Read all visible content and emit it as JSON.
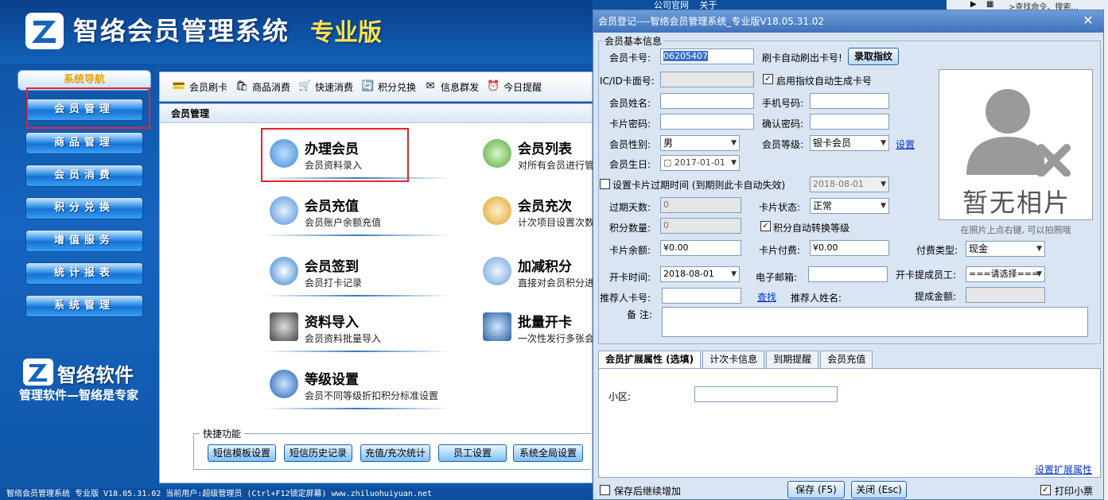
{
  "main": {
    "app_title": "智络会员管理系统",
    "app_edition": "专业版",
    "nav_title": "系统导航",
    "nav_items": [
      "会员管理",
      "商品管理",
      "会员消费",
      "积分兑换",
      "增值服务",
      "统计报表",
      "系统管理"
    ],
    "brand_name": "智络软件",
    "brand_slogan": "管理软件—智络是专家",
    "toolbar": [
      "会员刷卡",
      "商品消费",
      "快速消费",
      "积分兑换",
      "信息群发",
      "今日提醒"
    ],
    "content_title": "会员管理",
    "features": [
      {
        "title": "办理会员",
        "desc": "会员资料录入"
      },
      {
        "title": "会员列表",
        "desc": "对所有会员进行管"
      },
      {
        "title": "会员充值",
        "desc": "会员账户余额充值"
      },
      {
        "title": "会员充次",
        "desc": "计次项目设置次数"
      },
      {
        "title": "会员签到",
        "desc": "会员打卡记录"
      },
      {
        "title": "加减积分",
        "desc": "直接对会员积分进"
      },
      {
        "title": "资料导入",
        "desc": "会员资料批量导入"
      },
      {
        "title": "批量开卡",
        "desc": "一次性发行多张会"
      },
      {
        "title": "等级设置",
        "desc": "会员不同等级折扣积分标准设置"
      }
    ],
    "quick_title": "快捷功能",
    "quick_buttons": [
      "短信模板设置",
      "短信历史记录",
      "充值/充次统计",
      "员工设置",
      "系统全局设置"
    ],
    "statusbar": "智络会员管理系统 专业版 V18.05.31.02 当前用户:超级管理员 (Ctrl+F12锁定屏幕)      www.zhiluohuiyuan.net",
    "top_links": [
      "公司官网",
      "关于"
    ],
    "top_search": ">查找命令、搜索..."
  },
  "dialog": {
    "title": "会员登记----智络会员管理系统_专业版V18.05.31.02",
    "close": "✕",
    "basic_legend": "会员基本信息",
    "card_no_label": "会员卡号:",
    "card_no_value": "06205407",
    "swipe_hint": "刷卡自动刷出卡号!",
    "fingerprint_button": "录取指纹",
    "icid_label": "IC/ID卡面号:",
    "auto_fp_label": "启用指纹自动生成卡号",
    "name_label": "会员姓名:",
    "phone_label": "手机号码:",
    "pwd_label": "卡片密码:",
    "confirm_pwd_label": "确认密码:",
    "gender_label": "会员性别:",
    "gender_value": "男",
    "level_label": "会员等级:",
    "level_value": "银卡会员",
    "level_link": "设置",
    "birthday_label": "会员生日:",
    "birthday_value": "2017-01-01",
    "expire_chk_label": "设置卡片过期时间 (到期则此卡自动失效)",
    "expire_value": "2018-08-01",
    "expire_days_label": "过期天数:",
    "expire_days_value": "0",
    "card_status_label": "卡片状态:",
    "card_status_value": "正常",
    "points_label": "积分数量:",
    "points_value": "0",
    "auto_level_label": "积分自动转换等级",
    "balance_label": "卡片余额:",
    "balance_value": "¥0.00",
    "card_fee_label": "卡片付费:",
    "card_fee_value": "¥0.00",
    "pay_type_label": "付费类型:",
    "pay_type_value": "现金",
    "open_time_label": "开卡时间:",
    "open_time_value": "2018-08-01",
    "email_label": "电子邮箱:",
    "staff_label": "开卡提成员工:",
    "staff_value": "===请选择===",
    "referrer_no_label": "推荐人卡号:",
    "search_link": "查找",
    "referrer_name_label": "推荐人姓名:",
    "commission_label": "提成金额:",
    "remark_label": "备  注:",
    "photo_placeholder": "暂无相片",
    "photo_hint": "在照片上点右键, 可以拍照哦",
    "tabs": [
      "会员扩展属性 (选填)",
      "计次卡信息",
      "到期提醒",
      "会员充值"
    ],
    "ext_field_label": "小区:",
    "ext_settings_link": "设置扩展属性",
    "continue_label": "保存后继续增加",
    "save_button": "保存 (F5)",
    "close_button": "关闭 (Esc)",
    "print_label": "打印小票",
    "check_mark": "✓"
  },
  "colors": {
    "accent": "#1565c0",
    "highlight": "#e8232a",
    "edition": "#ffe34d"
  }
}
